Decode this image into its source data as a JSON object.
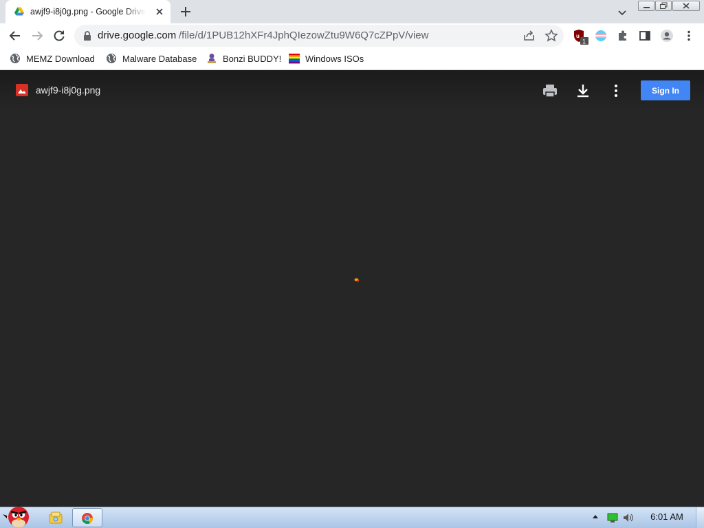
{
  "browser": {
    "tab": {
      "title": "awjf9-i8j0g.png - Google Drive"
    },
    "omnibox": {
      "host": "drive.google.com",
      "path": "/file/d/1PUB12hXFr4JphQIezowZtu9W6Q7cZPpV/view"
    },
    "extensions": {
      "ublock_badge": "1"
    },
    "bookmarks": [
      {
        "label": "MEMZ Download",
        "icon": "globe-icon"
      },
      {
        "label": "Malware Database",
        "icon": "globe-icon"
      },
      {
        "label": "Bonzi BUDDY!",
        "icon": "bonzi-icon"
      },
      {
        "label": "Windows ISOs",
        "icon": "rainbow-flag-icon"
      }
    ]
  },
  "viewer": {
    "file_name": "awjf9-i8j0g.png",
    "sign_in_label": "Sign In"
  },
  "taskbar": {
    "clock": "6:01 AM"
  },
  "colors": {
    "accent": "#4285f4",
    "viewer_bg": "#262626",
    "file_icon": "#d93025"
  }
}
